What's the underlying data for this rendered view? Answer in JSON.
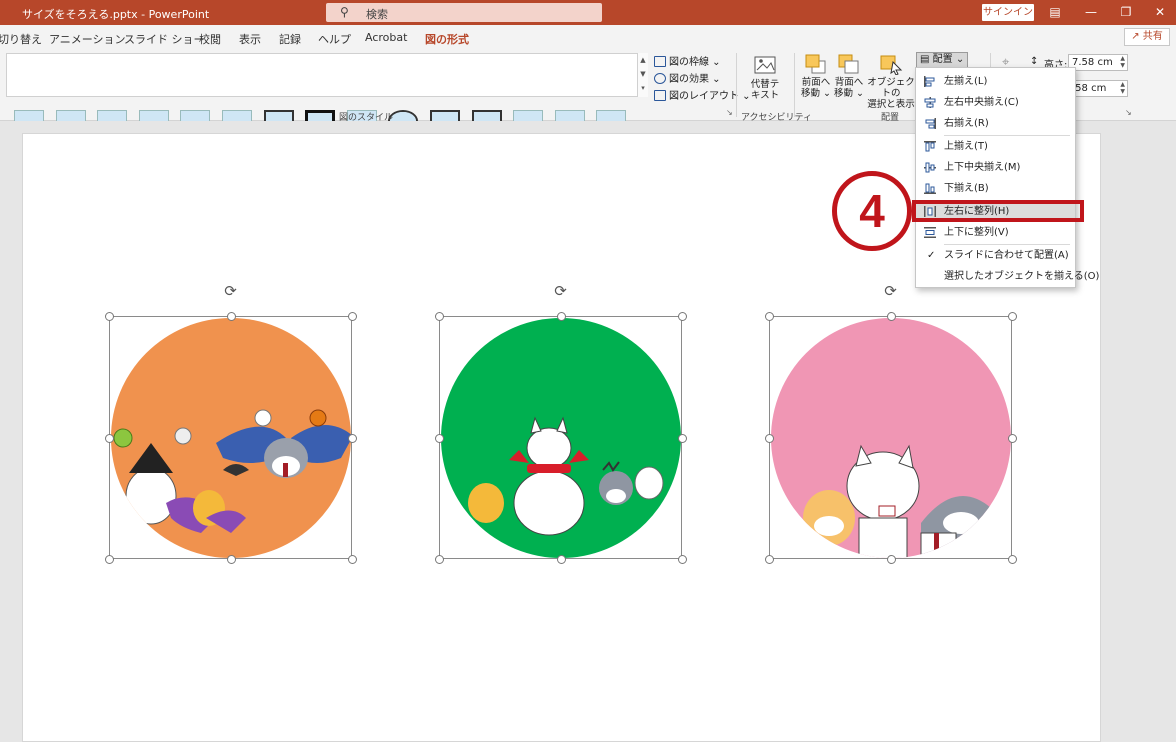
{
  "titlebar": {
    "file_title": "サイズをそろえる.pptx - PowerPoint",
    "search_placeholder": "検索",
    "signin_label": "サインイン"
  },
  "menu": {
    "tabs": [
      {
        "label": "切り替え"
      },
      {
        "label": "アニメーション"
      },
      {
        "label": "スライド ショー"
      },
      {
        "label": "校閲"
      },
      {
        "label": "表示"
      },
      {
        "label": "記録"
      },
      {
        "label": "ヘルプ"
      },
      {
        "label": "Acrobat"
      },
      {
        "label": "図の形式",
        "active": true
      }
    ],
    "share_label": "共有"
  },
  "ribbon": {
    "picture_border": "図の枠線",
    "picture_effects": "図の効果",
    "picture_layout": "図のレイアウト",
    "styles_group": "図のスタイル",
    "alt_text_line1": "代替テ",
    "alt_text_line2": "キスト",
    "accessibility_group": "アクセシビリティ",
    "bring_forward_line1": "前面へ",
    "bring_forward_line2": "移動",
    "send_backward_line1": "背面へ",
    "send_backward_line2": "移動",
    "selection_pane_line1": "オブジェクトの",
    "selection_pane_line2": "選択と表示",
    "arrange_group": "配置",
    "align_button": "配置",
    "height_label": "高さ:",
    "height_value": "7.58 cm",
    "width_value": ".58 cm"
  },
  "align_menu": {
    "items": [
      {
        "label": "左揃え(L)"
      },
      {
        "label": "左右中央揃え(C)"
      },
      {
        "label": "右揃え(R)"
      },
      {
        "label": "上揃え(T)"
      },
      {
        "label": "上下中央揃え(M)"
      },
      {
        "label": "下揃え(B)"
      },
      {
        "label": "左右に整列(H)",
        "highlighted": true
      },
      {
        "label": "上下に整列(V)"
      },
      {
        "label": "スライドに合わせて配置(A)",
        "checked": true
      },
      {
        "label": "選択したオブジェクトを揃える(O)"
      }
    ]
  },
  "annotation": {
    "step_number": "4",
    "color": "#c0151b"
  },
  "slide": {
    "pictures": [
      {
        "name": "halloween",
        "bg_color": "#f0924e"
      },
      {
        "name": "winter",
        "bg_color": "#00b050"
      },
      {
        "name": "friends",
        "bg_color": "#f096b4"
      }
    ]
  },
  "colors": {
    "accent": "#b7472a",
    "highlight": "#c0151b"
  }
}
